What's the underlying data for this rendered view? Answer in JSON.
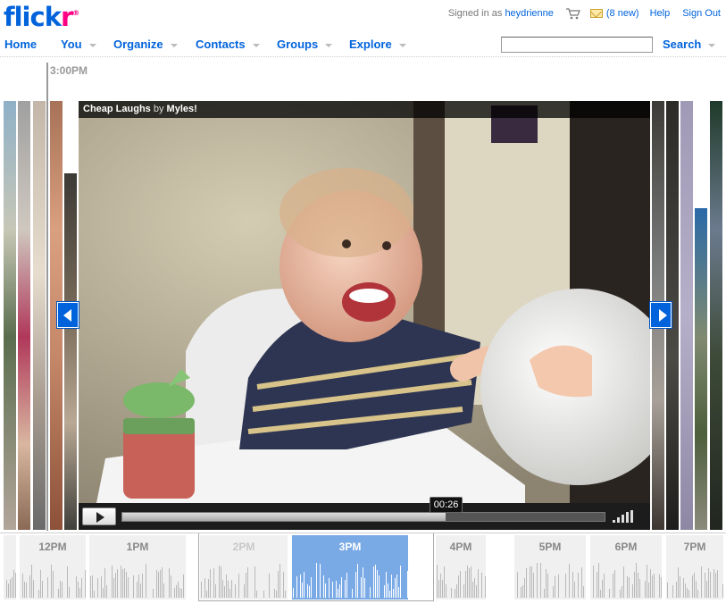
{
  "header": {
    "logo_main": "flick",
    "logo_accent": "r",
    "logo_mark": "®",
    "signed_in_prefix": "Signed in as",
    "username": "heydrienne",
    "mail_count": "(8 new)",
    "help": "Help",
    "sign_out": "Sign Out"
  },
  "nav": {
    "home": "Home",
    "you": "You",
    "organize": "Organize",
    "contacts": "Contacts",
    "groups": "Groups",
    "explore": "Explore",
    "search": "Search"
  },
  "search": {
    "placeholder": ""
  },
  "current_time": "3:00PM",
  "video": {
    "title": "Cheap Laughs",
    "by": "by",
    "author": "Myles!",
    "timecode": "00:26",
    "progress": 0.67
  },
  "timeline": {
    "hours": [
      {
        "label": "12PM",
        "state": "normal"
      },
      {
        "label": "1PM",
        "state": "normal"
      },
      {
        "label": "2PM",
        "state": "dim"
      },
      {
        "label": "3PM",
        "state": "active"
      },
      {
        "label": "4PM",
        "state": "normal"
      },
      {
        "label": "5PM",
        "state": "normal"
      },
      {
        "label": "6PM",
        "state": "normal"
      },
      {
        "label": "7PM",
        "state": "normal"
      }
    ]
  },
  "colors": {
    "brand_blue": "#0063dc",
    "brand_pink": "#ff0084",
    "timeline_active": "#7aaae6"
  }
}
